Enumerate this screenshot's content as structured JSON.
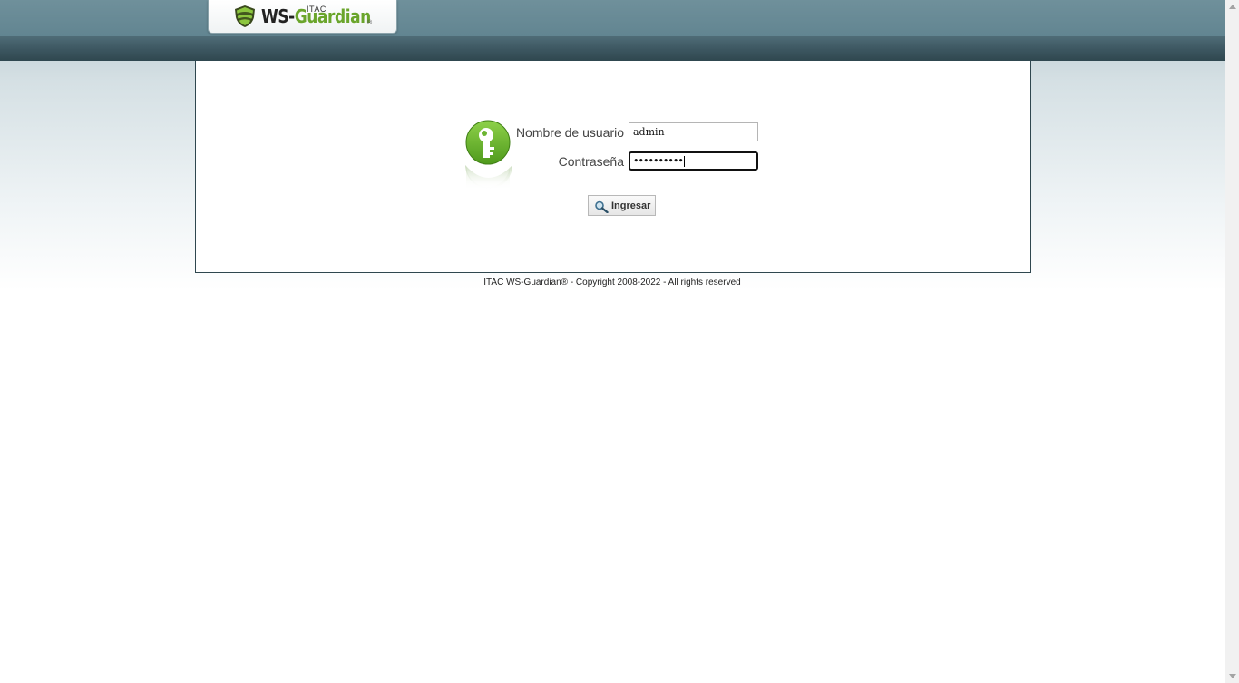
{
  "header": {
    "logo": {
      "brand_small": "ITAC",
      "brand_prefix": "WS-",
      "brand_main": "Guardian",
      "reg_mark": "®"
    }
  },
  "login": {
    "username_label": "Nombre de usuario",
    "username_value": "admin",
    "password_label": "Contraseña",
    "password_value": "••••••••••",
    "submit_label": "Ingresar",
    "icon": "key-icon",
    "button_icon": "magnifier-icon"
  },
  "footer": {
    "text": "ITAC WS-Guardian® - Copyright 2008-2022 - All rights reserved"
  },
  "colors": {
    "brand_green": "#6aa52b",
    "header_bar": "#628591",
    "nav_bar": "#3c5660"
  }
}
